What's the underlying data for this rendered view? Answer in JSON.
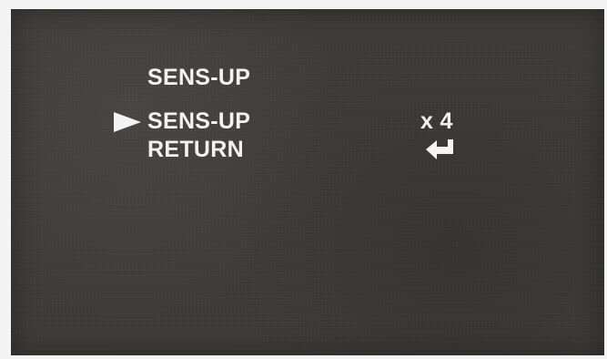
{
  "osd_menu": {
    "title": "SENS-UP",
    "items": [
      {
        "label": "SENS-UP",
        "value": "x 4",
        "selected": true
      },
      {
        "label": "RETURN",
        "icon": "enter-return-icon",
        "selected": false
      }
    ],
    "cursor_icon": "right-triangle-pointer-icon"
  },
  "colors": {
    "screen_background": "#3e3b38",
    "osd_text": "#f2f2f2"
  }
}
